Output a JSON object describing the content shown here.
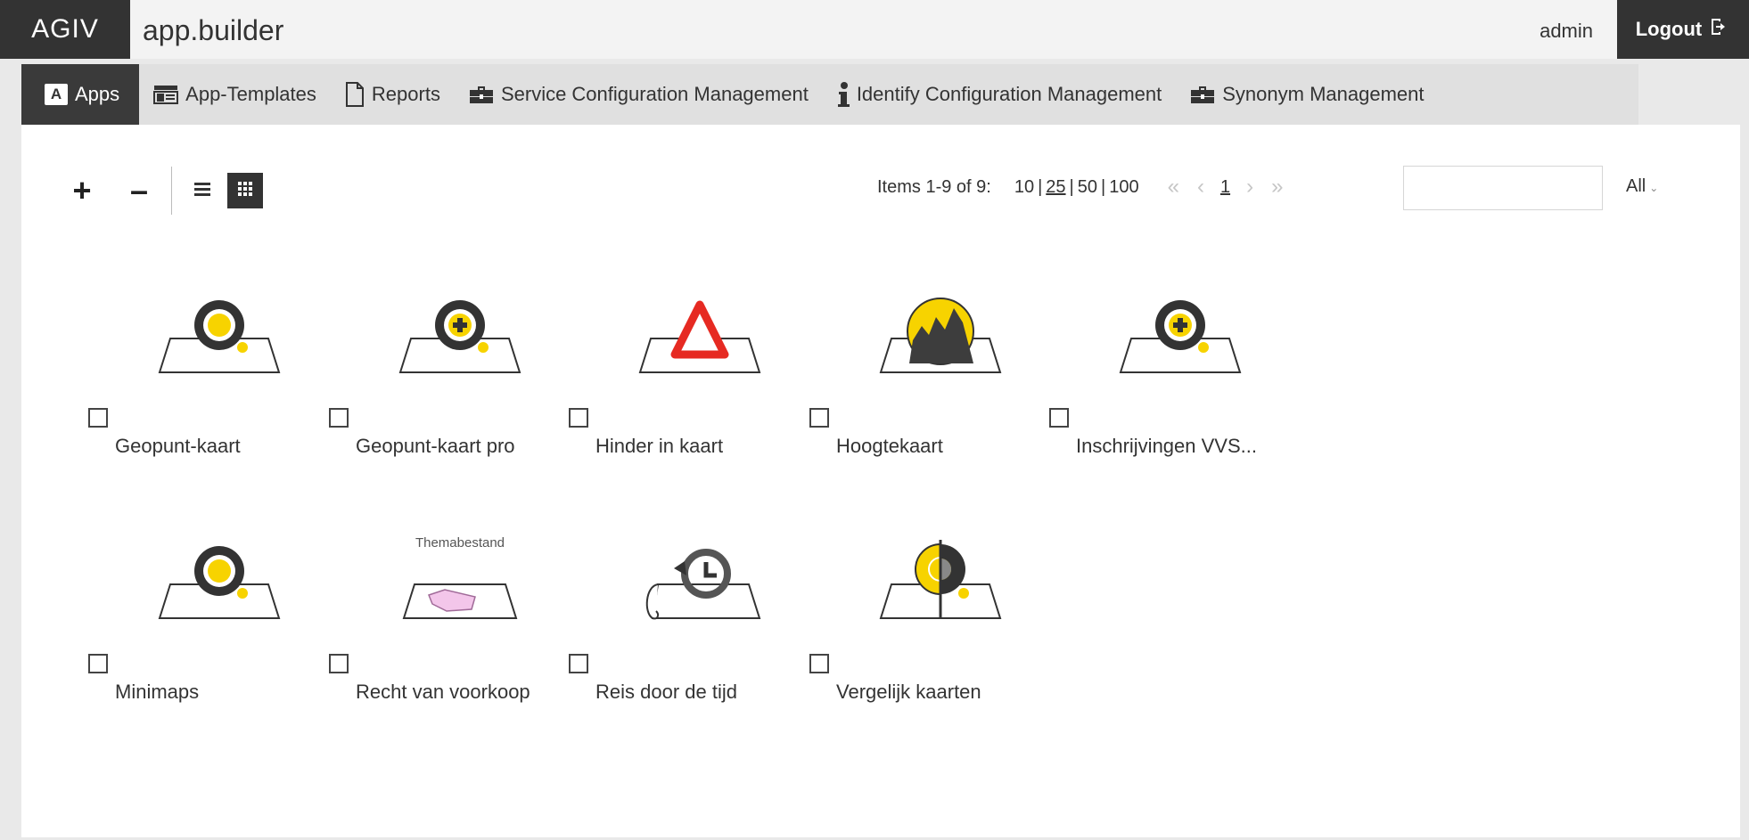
{
  "header": {
    "brand": "AGIV",
    "app_title": "app.builder",
    "user": "admin",
    "logout_label": "Logout"
  },
  "tabs": [
    {
      "label": "Apps",
      "icon": "apps-icon",
      "active": true
    },
    {
      "label": "App-Templates",
      "icon": "template-icon"
    },
    {
      "label": "Reports",
      "icon": "document-icon"
    },
    {
      "label": "Service Configuration Management",
      "icon": "toolbox-icon"
    },
    {
      "label": "Identify Configuration Management",
      "icon": "info-icon"
    },
    {
      "label": "Synonym Management",
      "icon": "toolbox-icon"
    }
  ],
  "toolbar": {
    "add": "+",
    "remove": "–"
  },
  "pager": {
    "items_label": "Items 1-9 of 9:",
    "sizes": [
      "10",
      "25",
      "50",
      "100"
    ],
    "current_page": "1",
    "search_value": "",
    "filter_label": "All"
  },
  "apps": [
    {
      "name": "Geopunt-kaart",
      "icon": "geopunt-map-icon"
    },
    {
      "name": "Geopunt-kaart pro",
      "icon": "geopunt-pro-map-icon"
    },
    {
      "name": "Hinder in kaart",
      "icon": "warning-triangle-map-icon"
    },
    {
      "name": "Hoogtekaart",
      "icon": "elevation-map-icon"
    },
    {
      "name": "Inschrijvingen VVS...",
      "icon": "geopunt-pro-map-icon"
    },
    {
      "name": "Minimaps",
      "icon": "geopunt-map-icon"
    },
    {
      "name": "Recht van voorkoop",
      "icon": "thematic-map-icon",
      "icon_caption": "Themabestand"
    },
    {
      "name": "Reis door de tijd",
      "icon": "history-map-icon"
    },
    {
      "name": "Vergelijk kaarten",
      "icon": "compare-map-icon"
    }
  ],
  "colors": {
    "dark": "#333333",
    "yellow": "#f7d300",
    "red": "#e62a22",
    "pink": "#f3c6ea"
  }
}
